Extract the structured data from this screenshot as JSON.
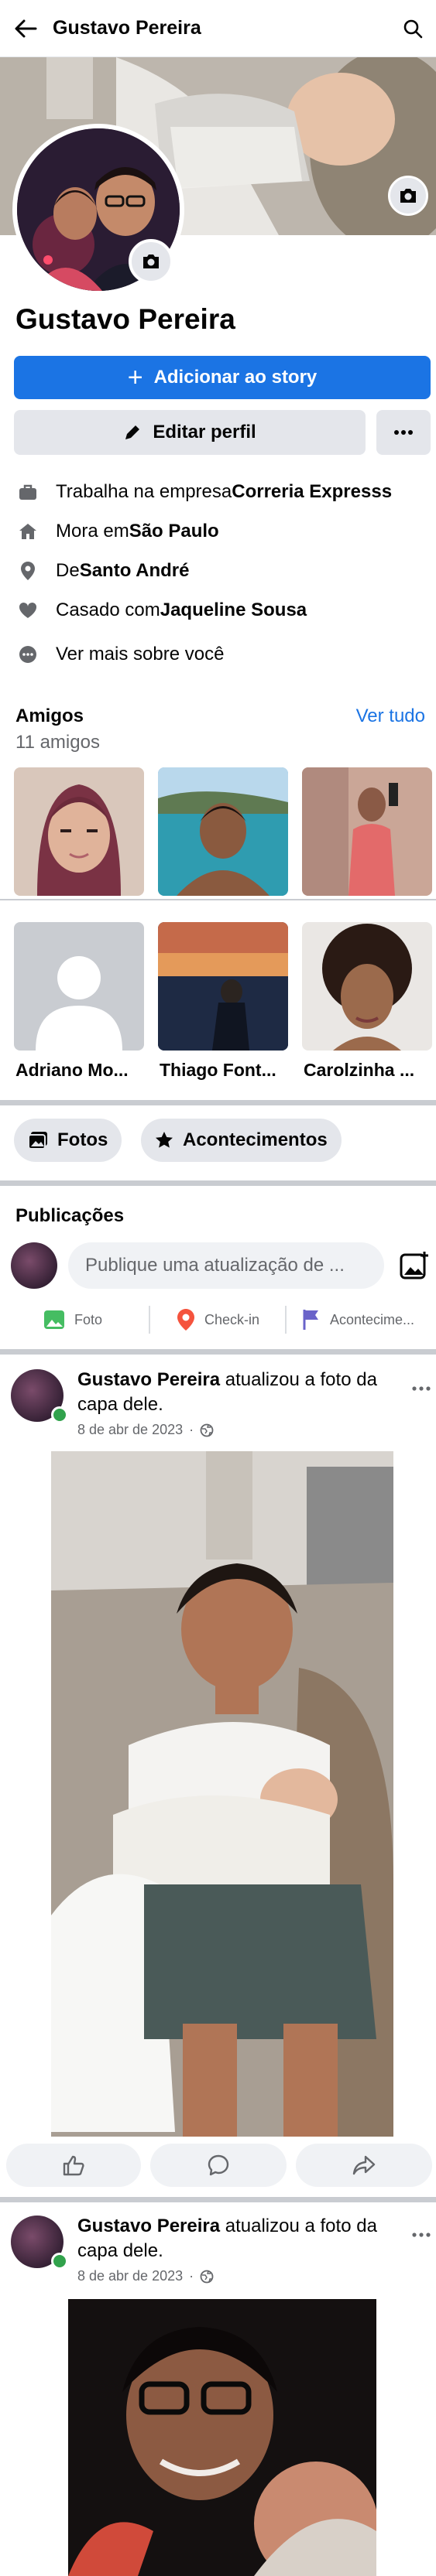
{
  "header": {
    "title": "Gustavo Pereira",
    "back_icon": "arrow-left-icon",
    "search_icon": "search-icon"
  },
  "profile": {
    "name": "Gustavo Pereira",
    "add_story_label": "Adicionar ao story",
    "edit_profile_label": "Editar perfil"
  },
  "details": [
    {
      "icon": "briefcase-icon",
      "prefix": "Trabalha na empresa ",
      "value": "Correria Expresss"
    },
    {
      "icon": "home-icon",
      "prefix": "Mora em ",
      "value": "São Paulo"
    },
    {
      "icon": "location-pin-icon",
      "prefix": "De ",
      "value": "Santo André"
    },
    {
      "icon": "heart-icon",
      "prefix": "Casado com ",
      "value": "Jaqueline Sousa"
    },
    {
      "icon": "more-dots-icon",
      "prefix": "Ver mais sobre você",
      "value": ""
    }
  ],
  "friends": {
    "title": "Amigos",
    "count": "11 amigos",
    "see_all": "Ver tudo",
    "names": [
      "Adriano Mo...",
      "Thiago Font...",
      "Carolzinha ..."
    ]
  },
  "chips": {
    "photos": "Fotos",
    "events": "Acontecimentos"
  },
  "publications": {
    "title": "Publicações",
    "composer_placeholder": "Publique uma atualização de ...",
    "actions": [
      "Foto",
      "Check-in",
      "Acontecime..."
    ]
  },
  "posts": [
    {
      "author": "Gustavo Pereira",
      "action": " atualizou a foto da capa dele.",
      "date": "8 de abr de 2023"
    },
    {
      "author": "Gustavo Pereira",
      "action": " atualizou a foto da capa dele.",
      "date": "8 de abr de 2023"
    }
  ],
  "colors": {
    "accent": "#1b74e4",
    "online": "#31a24c",
    "secondary_text": "#65676b",
    "button_gray": "#e4e6eb"
  }
}
